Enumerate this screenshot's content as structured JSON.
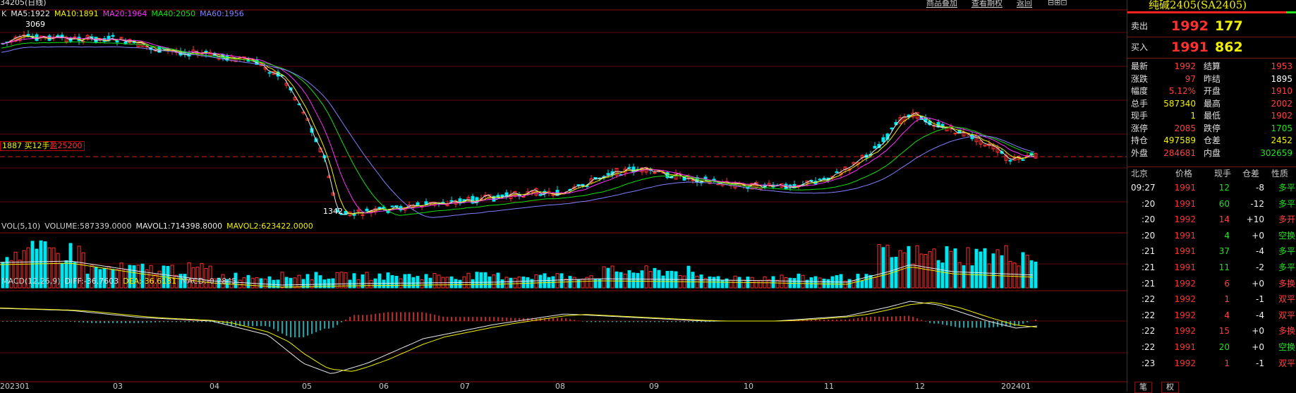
{
  "top_bar": {
    "contract_left": "34205(日线)",
    "buttons": [
      "商品叠加",
      "查看期权",
      "返回"
    ]
  },
  "main_chart": {
    "ma_legend": [
      {
        "label": "K",
        "color": "#d0d0d0"
      },
      {
        "label": "MA5:1922",
        "color": "#e8e8e8"
      },
      {
        "label": "MA10:1891",
        "color": "#f0f000"
      },
      {
        "label": "MA20:1964",
        "color": "#ff30ff"
      },
      {
        "label": "MA40:2050",
        "color": "#10e010"
      },
      {
        "label": "MA60:1956",
        "color": "#8080ff"
      }
    ],
    "high_label": "3069",
    "low_label": "1342",
    "position_tag": {
      "text1": "1887 买12手",
      "text2": "盈25200"
    }
  },
  "volume": {
    "legend": [
      {
        "label": "VOL(5,10)",
        "color": "#d0d0d0"
      },
      {
        "label": "VOLUME:587339.0000",
        "color": "#d0d0d0"
      },
      {
        "label": "MAVOL1:714398.8000",
        "color": "#e8e8e8"
      },
      {
        "label": "MAVOL2:623422.0000",
        "color": "#f0f000"
      }
    ]
  },
  "macd": {
    "legend": [
      {
        "label": "MACD(12,26,9)",
        "color": "#d0d0d0"
      },
      {
        "label": "DIFF:-36.7603",
        "color": "#e8e8e8"
      },
      {
        "label": "DEA:-36.6181",
        "color": "#f0f000"
      },
      {
        "label": "MACD:-0.2845",
        "color": "#d0d0d0"
      }
    ]
  },
  "x_axis": [
    "202301",
    "03",
    "04",
    "05",
    "06",
    "07",
    "08",
    "09",
    "10",
    "11",
    "12",
    "202401"
  ],
  "quote": {
    "title": "纯碱2405(SA2405)",
    "sell_label": "卖出",
    "sell_price": "1992",
    "sell_vol": "177",
    "buy_label": "买入",
    "buy_price": "1991",
    "buy_vol": "862",
    "stats": [
      {
        "l1": "最新",
        "v1": "1992",
        "c1": "#ff4040",
        "l2": "结算",
        "v2": "1953",
        "c2": "#ff4040"
      },
      {
        "l1": "涨跌",
        "v1": "97",
        "c1": "#ff4040",
        "l2": "昨结",
        "v2": "1895",
        "c2": "#ffffff"
      },
      {
        "l1": "幅度",
        "v1": "5.12%",
        "c1": "#ff4040",
        "l2": "开盘",
        "v2": "1910",
        "c2": "#ff4040"
      },
      {
        "l1": "总手",
        "v1": "587340",
        "c1": "#f0f000",
        "l2": "最高",
        "v2": "2002",
        "c2": "#ff4040"
      },
      {
        "l1": "现手",
        "v1": "1",
        "c1": "#f0f000",
        "l2": "最低",
        "v2": "1902",
        "c2": "#ff4040"
      },
      {
        "l1": "涨停",
        "v1": "2085",
        "c1": "#ff4040",
        "l2": "跌停",
        "v2": "1705",
        "c2": "#20e020"
      },
      {
        "l1": "持仓",
        "v1": "497589",
        "c1": "#f0f000",
        "l2": "仓差",
        "v2": "2452",
        "c2": "#f0f000"
      },
      {
        "l1": "外盘",
        "v1": "284681",
        "c1": "#ff4040",
        "l2": "内盘",
        "v2": "302659",
        "c2": "#20e020"
      }
    ],
    "tick_header": [
      "北京",
      "价格",
      "现手",
      "仓差",
      "性质"
    ],
    "ticks": [
      {
        "t": "09:27",
        "p": "1991",
        "v": "12",
        "d": "-8",
        "n": "多平",
        "vc": "#20e020",
        "dc": "#f0f0f0",
        "nc": "#20e020"
      },
      {
        "t": ":20",
        "p": "1991",
        "v": "60",
        "d": "-12",
        "n": "多平",
        "vc": "#20e020",
        "dc": "#f0f0f0",
        "nc": "#20e020"
      },
      {
        "t": ":20",
        "p": "1992",
        "v": "14",
        "d": "+10",
        "n": "多开",
        "vc": "#ff4040",
        "dc": "#f0f0f0",
        "nc": "#ff4040"
      },
      {
        "t": ":20",
        "p": "1991",
        "v": "4",
        "d": "+0",
        "n": "空换",
        "vc": "#20e020",
        "dc": "#f0f0f0",
        "nc": "#20e020"
      },
      {
        "t": ":21",
        "p": "1991",
        "v": "37",
        "d": "-4",
        "n": "多平",
        "vc": "#20e020",
        "dc": "#f0f0f0",
        "nc": "#20e020"
      },
      {
        "t": ":21",
        "p": "1991",
        "v": "11",
        "d": "-2",
        "n": "多平",
        "vc": "#20e020",
        "dc": "#f0f0f0",
        "nc": "#20e020"
      },
      {
        "t": ":21",
        "p": "1992",
        "v": "6",
        "d": "+0",
        "n": "多换",
        "vc": "#ff4040",
        "dc": "#f0f0f0",
        "nc": "#ff4040"
      },
      {
        "t": ":22",
        "p": "1992",
        "v": "1",
        "d": "-1",
        "n": "双平",
        "vc": "#ff4040",
        "dc": "#f0f0f0",
        "nc": "#ff4040"
      },
      {
        "t": ":22",
        "p": "1992",
        "v": "4",
        "d": "-4",
        "n": "双平",
        "vc": "#ff4040",
        "dc": "#f0f0f0",
        "nc": "#ff4040"
      },
      {
        "t": ":22",
        "p": "1992",
        "v": "15",
        "d": "+0",
        "n": "多换",
        "vc": "#ff4040",
        "dc": "#f0f0f0",
        "nc": "#ff4040"
      },
      {
        "t": ":22",
        "p": "1991",
        "v": "20",
        "d": "+0",
        "n": "空换",
        "vc": "#20e020",
        "dc": "#f0f0f0",
        "nc": "#20e020"
      },
      {
        "t": ":23",
        "p": "1992",
        "v": "1",
        "d": "-1",
        "n": "双平",
        "vc": "#ff4040",
        "dc": "#f0f0f0",
        "nc": "#ff4040"
      }
    ],
    "tabs": [
      "笔",
      "权"
    ]
  },
  "colors": {
    "up": "#ff3030",
    "down": "#00e5ee",
    "grid": "#5a0a0a",
    "axis": "#8a1010"
  }
}
